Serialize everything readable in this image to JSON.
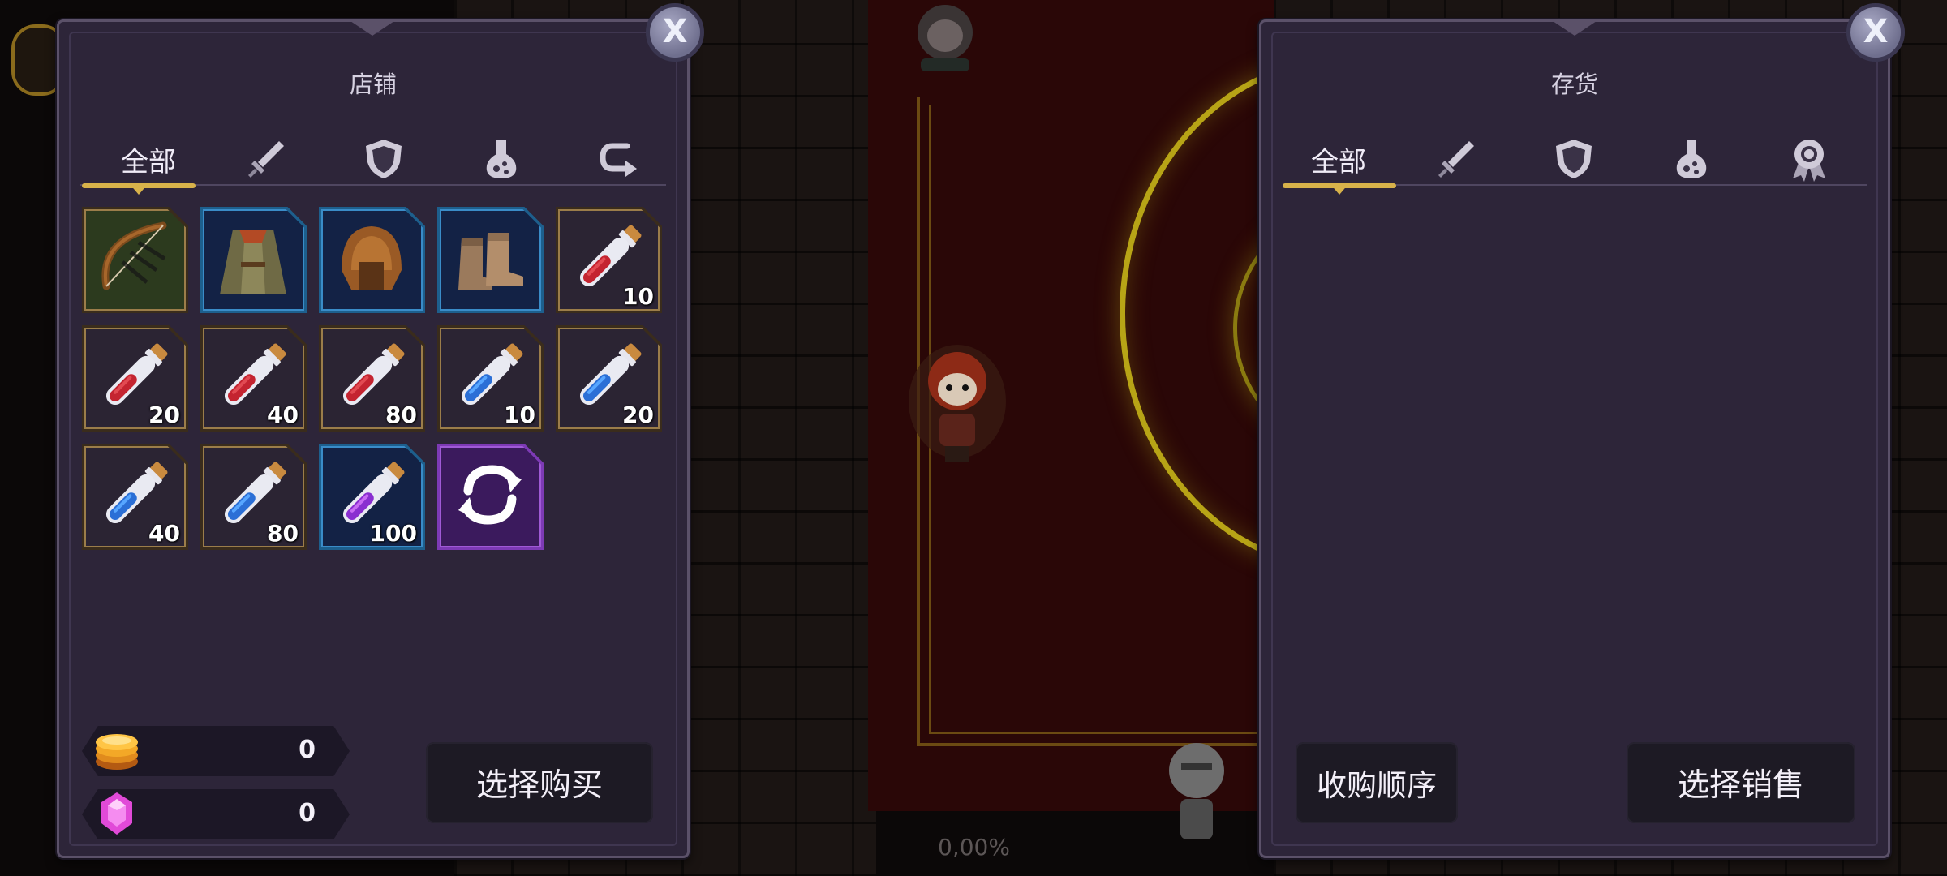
{
  "hud": {
    "progress_text": "0,00%"
  },
  "shop": {
    "title": "店铺",
    "close_label": "X",
    "tabs": [
      {
        "label": "全部",
        "icon": "all",
        "active": true
      },
      {
        "label": "",
        "icon": "sword-icon"
      },
      {
        "label": "",
        "icon": "shield-icon"
      },
      {
        "label": "",
        "icon": "potion-icon"
      },
      {
        "label": "",
        "icon": "return-arrow-icon"
      }
    ],
    "items": [
      {
        "name": "bow",
        "rarity": "green",
        "qty": ""
      },
      {
        "name": "cloak-armor",
        "rarity": "rare",
        "qty": ""
      },
      {
        "name": "leather-helmet",
        "rarity": "rare",
        "qty": ""
      },
      {
        "name": "leather-boots",
        "rarity": "rare",
        "qty": ""
      },
      {
        "name": "red-potion",
        "rarity": "common",
        "qty": "10"
      },
      {
        "name": "red-potion",
        "rarity": "common",
        "qty": "20"
      },
      {
        "name": "red-potion",
        "rarity": "common",
        "qty": "40"
      },
      {
        "name": "red-potion",
        "rarity": "common",
        "qty": "80"
      },
      {
        "name": "blue-potion",
        "rarity": "common",
        "qty": "10"
      },
      {
        "name": "blue-potion",
        "rarity": "common",
        "qty": "20"
      },
      {
        "name": "blue-potion",
        "rarity": "common",
        "qty": "40"
      },
      {
        "name": "blue-potion",
        "rarity": "common",
        "qty": "80"
      },
      {
        "name": "purple-potion",
        "rarity": "rare",
        "qty": "100"
      },
      {
        "name": "refresh",
        "rarity": "epic",
        "qty": ""
      }
    ],
    "gold": "0",
    "gems": "0",
    "buy_button": "选择购买"
  },
  "inventory": {
    "title": "存货",
    "close_label": "X",
    "tabs": [
      {
        "label": "全部",
        "icon": "all",
        "active": true
      },
      {
        "label": "",
        "icon": "sword-icon"
      },
      {
        "label": "",
        "icon": "shield-icon"
      },
      {
        "label": "",
        "icon": "potion-icon"
      },
      {
        "label": "",
        "icon": "badge-icon"
      }
    ],
    "buyback_button": "收购顺序",
    "sell_button": "选择销售"
  },
  "colors": {
    "panel_bg": "#2d2539",
    "tab_indicator": "#d7b24a",
    "rare_frame": "#1d5f8d",
    "epic_frame": "#7d3ab5"
  }
}
